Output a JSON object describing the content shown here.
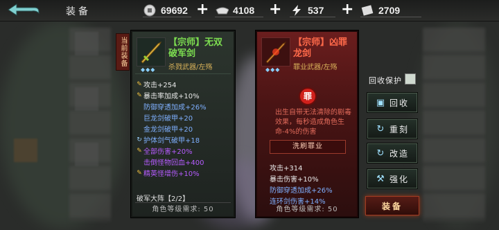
{
  "header": {
    "title": "装备",
    "resources": [
      {
        "icon": "coin-icon",
        "value": "69692"
      },
      {
        "icon": "ingot-icon",
        "value": "4108"
      },
      {
        "icon": "lightning-icon",
        "value": "537"
      },
      {
        "icon": "ticket-icon",
        "value": "2709"
      }
    ],
    "plus": "+"
  },
  "left_item": {
    "tag": "当前装备",
    "name_line1": "【宗师】无双",
    "name_line2": "破军剑",
    "type": "杀戮武器/左殇",
    "stats": [
      {
        "text": "攻击+254",
        "color": "#e8e8e8",
        "icon": true
      },
      {
        "text": "暴击率加成+10%",
        "color": "#e8e8e8",
        "icon": true
      },
      {
        "text": "防御穿透加成+26%",
        "color": "#7fb0ff",
        "icon": false
      },
      {
        "text": "巨龙剑破甲+20",
        "color": "#7fb0ff",
        "icon": false
      },
      {
        "text": "金龙剑破甲+20",
        "color": "#7fb0ff",
        "icon": false
      },
      {
        "text": "护体剑气破甲+18",
        "color": "#7fb0ff",
        "icon": true
      },
      {
        "text": "全部伤害+20%",
        "color": "#b65cff",
        "icon": true
      },
      {
        "text": "击倒怪物回血+400",
        "color": "#b65cff",
        "icon": false
      },
      {
        "text": "精英怪增伤+10%",
        "color": "#b65cff",
        "icon": true
      }
    ],
    "set": "破军大阵【2/2】",
    "requirement": "角色等级需求: 50"
  },
  "right_item": {
    "name_line1": "【宗师】凶罪",
    "name_line2": "龙剑",
    "type": "罪业武器/左殇",
    "seal": "罪",
    "curse": "出生自带无法清除的剧毒效果，每秒造成角色生命-4%的伤害",
    "clear_button": "洗刷罪业",
    "stats": [
      {
        "text": "攻击+314",
        "color": "#e8e8e8"
      },
      {
        "text": "暴击伤害+10%",
        "color": "#e8e8e8"
      },
      {
        "text": "防御穿透加成+26%",
        "color": "#7fb0ff"
      },
      {
        "text": "连环剑伤害+14%",
        "color": "#7fb0ff"
      }
    ],
    "requirement": "角色等级需求: 50"
  },
  "actions": {
    "protect_label": "回收保护",
    "recycle": "回收",
    "reforge": "重刻",
    "transform": "改造",
    "enhance": "强化",
    "equip": "装备"
  },
  "colors": {
    "left_name": "#7cdc50",
    "right_name": "#ff6a4a",
    "type": "#d9b25a"
  }
}
